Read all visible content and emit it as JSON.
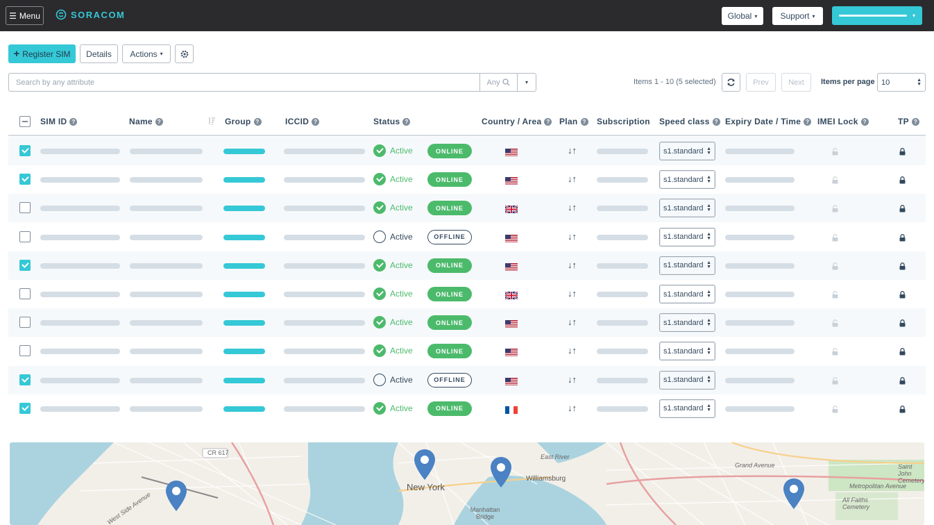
{
  "topbar": {
    "menu_label": "Menu",
    "logo_text": "SORACOM",
    "global_label": "Global",
    "support_label": "Support"
  },
  "toolbar": {
    "register_label": "Register SIM",
    "details_label": "Details",
    "actions_label": "Actions"
  },
  "search": {
    "placeholder": "Search by any attribute",
    "scope_label": "Any"
  },
  "pagination": {
    "items_info": "Items 1 - 10 (5 selected)",
    "prev_label": "Prev",
    "next_label": "Next",
    "items_per_page_label": "Items per page",
    "items_per_page_value": "10"
  },
  "table": {
    "columns": [
      "SIM ID",
      "Name",
      "Group",
      "ICCID",
      "Status",
      "Country / Area",
      "Plan",
      "Subscription",
      "Speed class",
      "Expiry Date / Time",
      "IMEI Lock",
      "TP"
    ],
    "rows": [
      {
        "checked": true,
        "status": "Active",
        "status_on": true,
        "session": "ONLINE",
        "country": "us",
        "plan": "↓↑",
        "speed_class": "s1.standard"
      },
      {
        "checked": true,
        "status": "Active",
        "status_on": true,
        "session": "ONLINE",
        "country": "us",
        "plan": "↓↑",
        "speed_class": "s1.standard"
      },
      {
        "checked": false,
        "status": "Active",
        "status_on": true,
        "session": "ONLINE",
        "country": "gb",
        "plan": "↓↑",
        "speed_class": "s1.standard"
      },
      {
        "checked": false,
        "status": "Active",
        "status_on": false,
        "session": "OFFLINE",
        "country": "us",
        "plan": "↓↑",
        "speed_class": "s1.standard"
      },
      {
        "checked": true,
        "status": "Active",
        "status_on": true,
        "session": "ONLINE",
        "country": "us",
        "plan": "↓↑",
        "speed_class": "s1.standard"
      },
      {
        "checked": false,
        "status": "Active",
        "status_on": true,
        "session": "ONLINE",
        "country": "gb",
        "plan": "↓↑",
        "speed_class": "s1.standard"
      },
      {
        "checked": false,
        "status": "Active",
        "status_on": true,
        "session": "ONLINE",
        "country": "us",
        "plan": "↓↑",
        "speed_class": "s1.standard"
      },
      {
        "checked": false,
        "status": "Active",
        "status_on": true,
        "session": "ONLINE",
        "country": "us",
        "plan": "↓↑",
        "speed_class": "s1.standard"
      },
      {
        "checked": true,
        "status": "Active",
        "status_on": false,
        "session": "OFFLINE",
        "country": "us",
        "plan": "↓↑",
        "speed_class": "s1.standard"
      },
      {
        "checked": true,
        "status": "Active",
        "status_on": true,
        "session": "ONLINE",
        "country": "fr",
        "plan": "↓↑",
        "speed_class": "s1.standard"
      }
    ]
  },
  "map": {
    "labels": [
      "New York",
      "Williamsburg",
      "Manhattan Bridge",
      "East River",
      "CR 617",
      "Metropolitan Avenue",
      "Grand Avenue",
      "Saint John Cemetery",
      "All Faiths Cemetery",
      "West Side Avenue"
    ]
  },
  "colors": {
    "accent": "#35c8d6",
    "online": "#4cba6b",
    "topbar": "#2b2b2e",
    "text": "#34495e",
    "placeholder_bar": "#d5dde5"
  },
  "icons": {
    "menu": "hamburger-icon",
    "settings": "gear-icon",
    "search": "magnifier-icon",
    "refresh": "refresh-icon",
    "help": "question-circle-icon",
    "lock": "padlock-icon",
    "sort": "sort-icon",
    "map_pin": "map-pin-icon"
  }
}
